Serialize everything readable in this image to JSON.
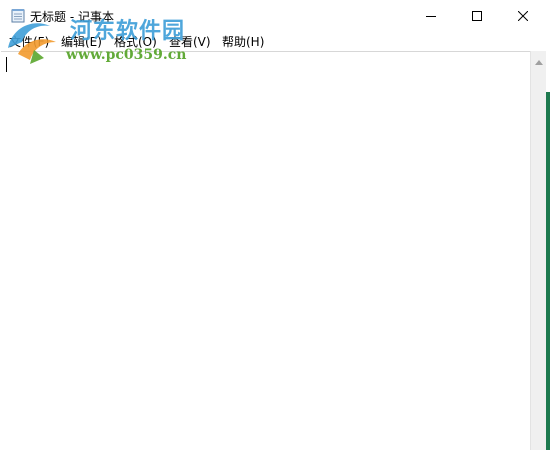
{
  "window": {
    "title": "无标题 - 记事本",
    "minimize_icon": "minimize-icon",
    "maximize_icon": "maximize-icon",
    "close_icon": "close-icon"
  },
  "menu": {
    "items": [
      {
        "label": "文件(F)"
      },
      {
        "label": "编辑(E)"
      },
      {
        "label": "格式(O)"
      },
      {
        "label": "查看(V)"
      },
      {
        "label": "帮助(H)"
      }
    ]
  },
  "editor": {
    "text": ""
  },
  "watermark": {
    "name": "河东软件园",
    "url": "www.pc0359.cn"
  },
  "colors": {
    "watermark_blue": "#3f9fd8",
    "watermark_green": "#5aa62e",
    "watermark_orange": "#f29a2e",
    "desktop_edge": "#1e7a4f"
  }
}
